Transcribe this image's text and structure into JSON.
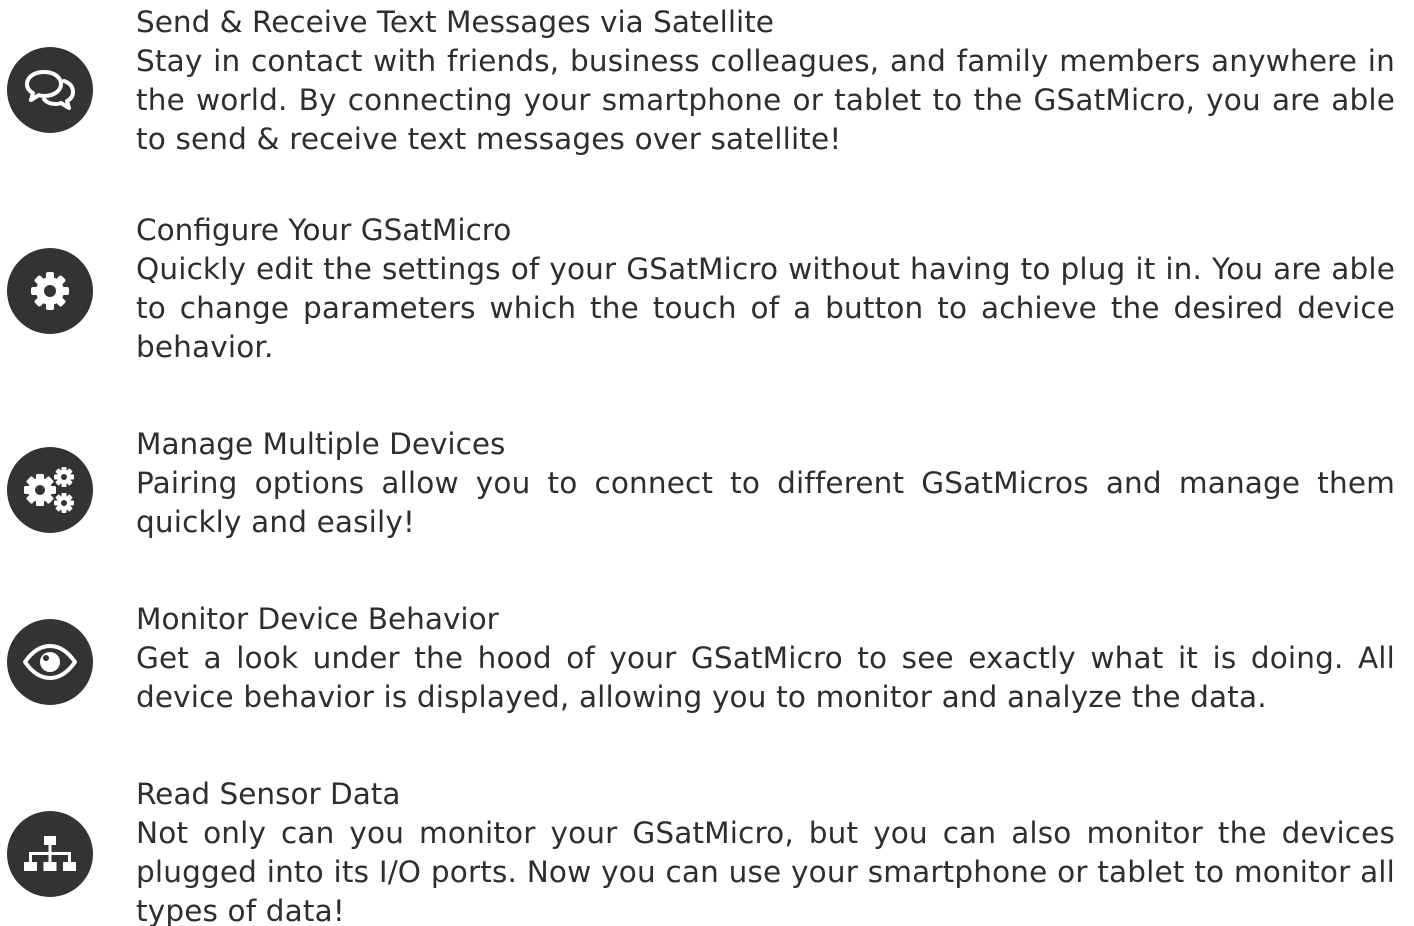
{
  "features": [
    {
      "icon": "chat-bubbles-icon",
      "title": "Send & Receive Text Messages via Satellite",
      "description": "Stay in contact with friends, business colleagues, and family members anywhere in the world.  By connecting your smartphone or tablet to the GSatMicro, you are able to send & receive text messages over satellite!"
    },
    {
      "icon": "gear-icon",
      "title": "Configure Your GSatMicro",
      "description": "Quickly edit the settings of your GSatMicro without having to plug it in.  You are able to change parameters which the touch of a button to achieve the desired device behavior."
    },
    {
      "icon": "gears-icon",
      "title": "Manage Multiple Devices",
      "description": "Pairing options allow you to connect to different GSatMicros and manage them quickly and easily!"
    },
    {
      "icon": "eye-icon",
      "title": "Monitor Device Behavior",
      "description": "Get a look under the hood of your GSatMicro to see exactly what it is doing.  All device behavior is displayed, allowing you to monitor and analyze the data."
    },
    {
      "icon": "sitemap-icon",
      "title": "Read Sensor Data",
      "description": "Not only can you monitor your GSatMicro, but you can also monitor the devices plugged into its I/O ports.  Now you can use your smartphone or tablet to monitor all types of data!"
    }
  ],
  "colors": {
    "icon_background": "#333333",
    "icon_foreground": "#ffffff",
    "text": "#2e2e2e"
  }
}
